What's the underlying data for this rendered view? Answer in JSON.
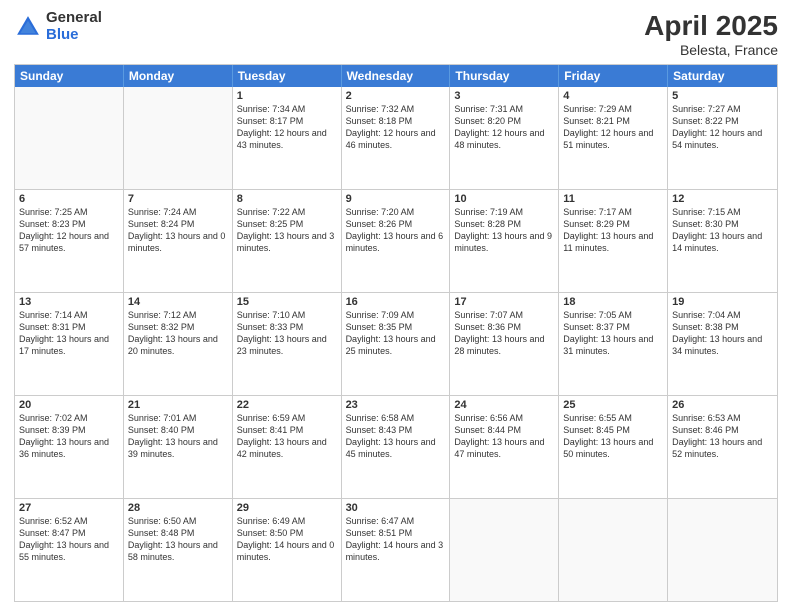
{
  "logo": {
    "general": "General",
    "blue": "Blue"
  },
  "title": {
    "month": "April 2025",
    "location": "Belesta, France"
  },
  "header_days": [
    "Sunday",
    "Monday",
    "Tuesday",
    "Wednesday",
    "Thursday",
    "Friday",
    "Saturday"
  ],
  "weeks": [
    [
      {
        "day": "",
        "sunrise": "",
        "sunset": "",
        "daylight": ""
      },
      {
        "day": "",
        "sunrise": "",
        "sunset": "",
        "daylight": ""
      },
      {
        "day": "1",
        "sunrise": "Sunrise: 7:34 AM",
        "sunset": "Sunset: 8:17 PM",
        "daylight": "Daylight: 12 hours and 43 minutes."
      },
      {
        "day": "2",
        "sunrise": "Sunrise: 7:32 AM",
        "sunset": "Sunset: 8:18 PM",
        "daylight": "Daylight: 12 hours and 46 minutes."
      },
      {
        "day": "3",
        "sunrise": "Sunrise: 7:31 AM",
        "sunset": "Sunset: 8:20 PM",
        "daylight": "Daylight: 12 hours and 48 minutes."
      },
      {
        "day": "4",
        "sunrise": "Sunrise: 7:29 AM",
        "sunset": "Sunset: 8:21 PM",
        "daylight": "Daylight: 12 hours and 51 minutes."
      },
      {
        "day": "5",
        "sunrise": "Sunrise: 7:27 AM",
        "sunset": "Sunset: 8:22 PM",
        "daylight": "Daylight: 12 hours and 54 minutes."
      }
    ],
    [
      {
        "day": "6",
        "sunrise": "Sunrise: 7:25 AM",
        "sunset": "Sunset: 8:23 PM",
        "daylight": "Daylight: 12 hours and 57 minutes."
      },
      {
        "day": "7",
        "sunrise": "Sunrise: 7:24 AM",
        "sunset": "Sunset: 8:24 PM",
        "daylight": "Daylight: 13 hours and 0 minutes."
      },
      {
        "day": "8",
        "sunrise": "Sunrise: 7:22 AM",
        "sunset": "Sunset: 8:25 PM",
        "daylight": "Daylight: 13 hours and 3 minutes."
      },
      {
        "day": "9",
        "sunrise": "Sunrise: 7:20 AM",
        "sunset": "Sunset: 8:26 PM",
        "daylight": "Daylight: 13 hours and 6 minutes."
      },
      {
        "day": "10",
        "sunrise": "Sunrise: 7:19 AM",
        "sunset": "Sunset: 8:28 PM",
        "daylight": "Daylight: 13 hours and 9 minutes."
      },
      {
        "day": "11",
        "sunrise": "Sunrise: 7:17 AM",
        "sunset": "Sunset: 8:29 PM",
        "daylight": "Daylight: 13 hours and 11 minutes."
      },
      {
        "day": "12",
        "sunrise": "Sunrise: 7:15 AM",
        "sunset": "Sunset: 8:30 PM",
        "daylight": "Daylight: 13 hours and 14 minutes."
      }
    ],
    [
      {
        "day": "13",
        "sunrise": "Sunrise: 7:14 AM",
        "sunset": "Sunset: 8:31 PM",
        "daylight": "Daylight: 13 hours and 17 minutes."
      },
      {
        "day": "14",
        "sunrise": "Sunrise: 7:12 AM",
        "sunset": "Sunset: 8:32 PM",
        "daylight": "Daylight: 13 hours and 20 minutes."
      },
      {
        "day": "15",
        "sunrise": "Sunrise: 7:10 AM",
        "sunset": "Sunset: 8:33 PM",
        "daylight": "Daylight: 13 hours and 23 minutes."
      },
      {
        "day": "16",
        "sunrise": "Sunrise: 7:09 AM",
        "sunset": "Sunset: 8:35 PM",
        "daylight": "Daylight: 13 hours and 25 minutes."
      },
      {
        "day": "17",
        "sunrise": "Sunrise: 7:07 AM",
        "sunset": "Sunset: 8:36 PM",
        "daylight": "Daylight: 13 hours and 28 minutes."
      },
      {
        "day": "18",
        "sunrise": "Sunrise: 7:05 AM",
        "sunset": "Sunset: 8:37 PM",
        "daylight": "Daylight: 13 hours and 31 minutes."
      },
      {
        "day": "19",
        "sunrise": "Sunrise: 7:04 AM",
        "sunset": "Sunset: 8:38 PM",
        "daylight": "Daylight: 13 hours and 34 minutes."
      }
    ],
    [
      {
        "day": "20",
        "sunrise": "Sunrise: 7:02 AM",
        "sunset": "Sunset: 8:39 PM",
        "daylight": "Daylight: 13 hours and 36 minutes."
      },
      {
        "day": "21",
        "sunrise": "Sunrise: 7:01 AM",
        "sunset": "Sunset: 8:40 PM",
        "daylight": "Daylight: 13 hours and 39 minutes."
      },
      {
        "day": "22",
        "sunrise": "Sunrise: 6:59 AM",
        "sunset": "Sunset: 8:41 PM",
        "daylight": "Daylight: 13 hours and 42 minutes."
      },
      {
        "day": "23",
        "sunrise": "Sunrise: 6:58 AM",
        "sunset": "Sunset: 8:43 PM",
        "daylight": "Daylight: 13 hours and 45 minutes."
      },
      {
        "day": "24",
        "sunrise": "Sunrise: 6:56 AM",
        "sunset": "Sunset: 8:44 PM",
        "daylight": "Daylight: 13 hours and 47 minutes."
      },
      {
        "day": "25",
        "sunrise": "Sunrise: 6:55 AM",
        "sunset": "Sunset: 8:45 PM",
        "daylight": "Daylight: 13 hours and 50 minutes."
      },
      {
        "day": "26",
        "sunrise": "Sunrise: 6:53 AM",
        "sunset": "Sunset: 8:46 PM",
        "daylight": "Daylight: 13 hours and 52 minutes."
      }
    ],
    [
      {
        "day": "27",
        "sunrise": "Sunrise: 6:52 AM",
        "sunset": "Sunset: 8:47 PM",
        "daylight": "Daylight: 13 hours and 55 minutes."
      },
      {
        "day": "28",
        "sunrise": "Sunrise: 6:50 AM",
        "sunset": "Sunset: 8:48 PM",
        "daylight": "Daylight: 13 hours and 58 minutes."
      },
      {
        "day": "29",
        "sunrise": "Sunrise: 6:49 AM",
        "sunset": "Sunset: 8:50 PM",
        "daylight": "Daylight: 14 hours and 0 minutes."
      },
      {
        "day": "30",
        "sunrise": "Sunrise: 6:47 AM",
        "sunset": "Sunset: 8:51 PM",
        "daylight": "Daylight: 14 hours and 3 minutes."
      },
      {
        "day": "",
        "sunrise": "",
        "sunset": "",
        "daylight": ""
      },
      {
        "day": "",
        "sunrise": "",
        "sunset": "",
        "daylight": ""
      },
      {
        "day": "",
        "sunrise": "",
        "sunset": "",
        "daylight": ""
      }
    ]
  ]
}
